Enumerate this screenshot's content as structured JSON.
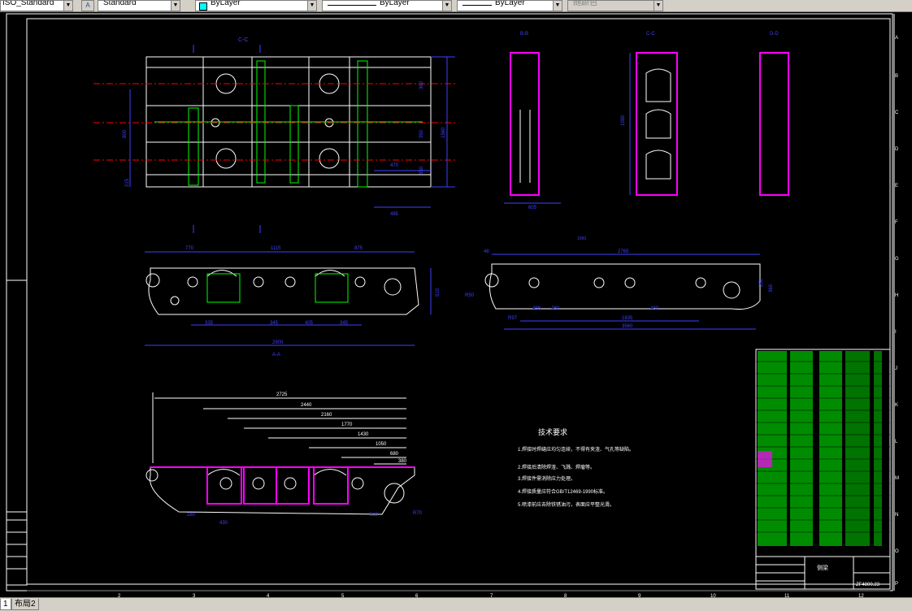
{
  "toolbar": {
    "dimstyle_value": "ISO_Standard",
    "textstyle_value": "Standard",
    "layer_value": "ByLayer",
    "linetype_value": "ByLayer",
    "lineweight_value": "ByLayer",
    "plotstyle_value": "随颜色"
  },
  "tabs": {
    "model_label": "1",
    "layout2_label": "布局2"
  },
  "drawing": {
    "view_labels": {
      "b_b": "B-B",
      "c_c": "C-C",
      "d_d": "D-D",
      "a_a": "A-A"
    },
    "dims_top_plan": [
      "800",
      "215",
      "1560",
      "350",
      "470",
      "485",
      "360",
      "350"
    ],
    "dims_side_view": [
      "770",
      "1115",
      "875",
      "335",
      "345",
      "405",
      "345",
      "2900",
      "510"
    ],
    "dims_right_side": [
      "48",
      "2765",
      "1835",
      "480",
      "430",
      "3560",
      "R50",
      "R97",
      "498",
      "250",
      "360",
      "1060"
    ],
    "dims_bottom_elev": [
      "2725",
      "2440",
      "2160",
      "1770",
      "1430",
      "1050",
      "680",
      "380",
      "430",
      "280",
      "510",
      "R70"
    ],
    "dims_sections": [
      "605",
      "1090"
    ],
    "notes_title": "技术要求",
    "notes": [
      "1.焊接时焊缝应均匀连续，不得有夹渣、气孔等缺陷。",
      "2.焊接后清除焊渣、飞溅、焊瘤等。",
      "3.焊接件需消除应力处理。",
      "4.焊接质量应符合GB/T12469-1990标准。",
      "5.喷漆前应去除铁锈油污，表面应平整光滑。"
    ],
    "title_block": {
      "drawing_no": "ZF4800.23",
      "part_name": "侧梁"
    },
    "ruler_bottom": [
      "2",
      "3",
      "4",
      "5",
      "6",
      "7",
      "8",
      "9",
      "10",
      "11",
      "12"
    ],
    "ruler_right": [
      "A",
      "B",
      "C",
      "D",
      "E",
      "F",
      "G",
      "H",
      "I",
      "J",
      "K",
      "L",
      "M",
      "N",
      "O",
      "P"
    ]
  }
}
